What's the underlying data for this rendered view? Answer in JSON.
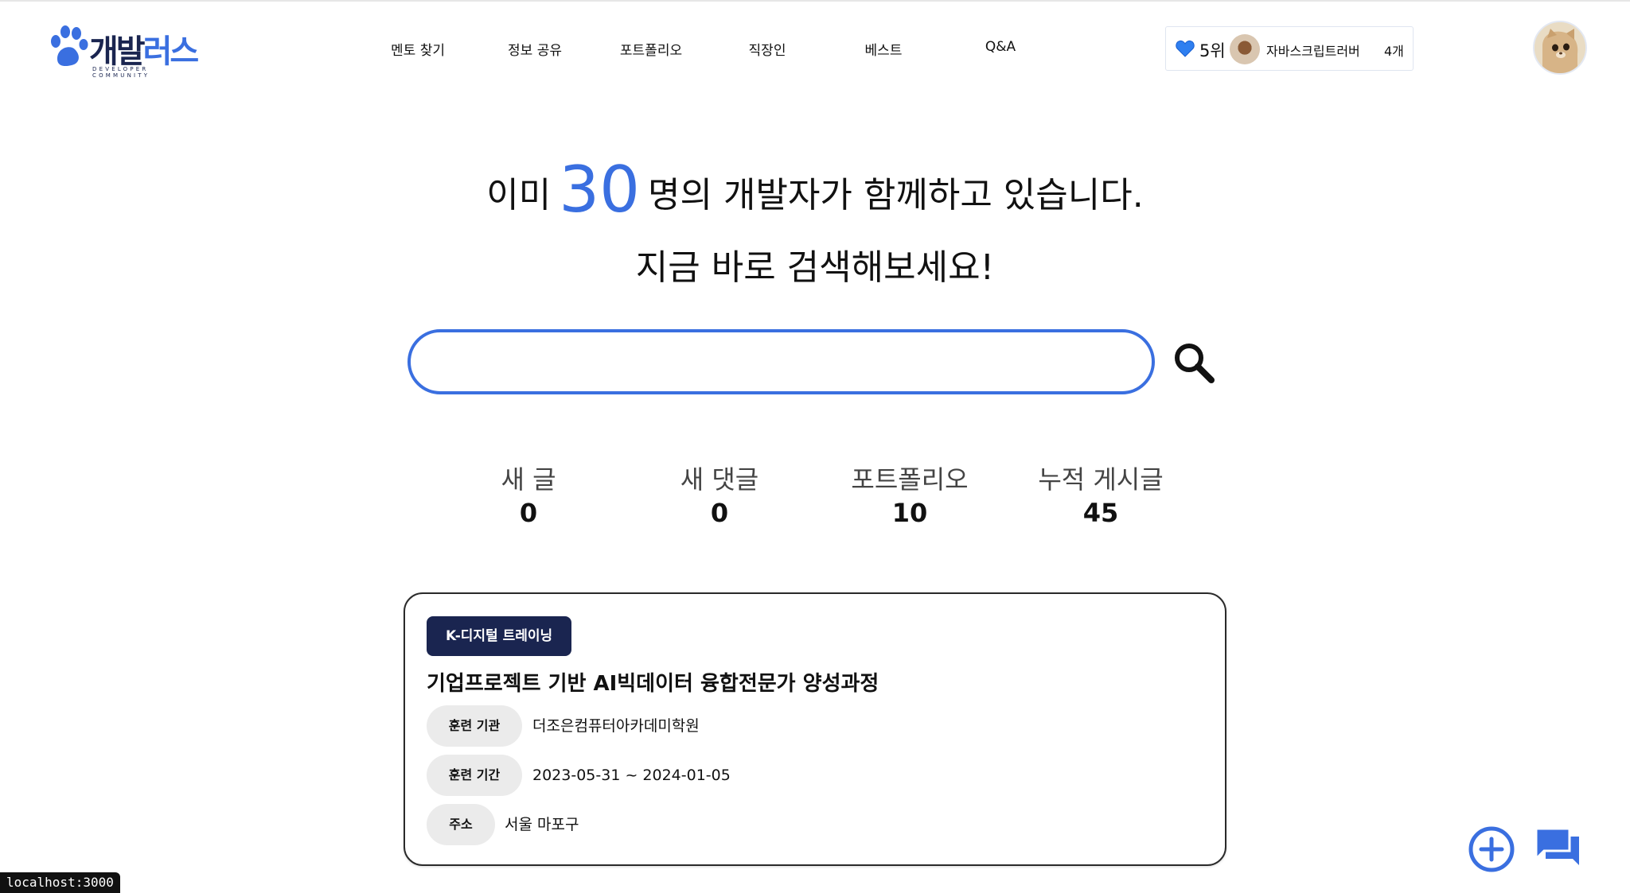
{
  "header": {
    "logo": {
      "text_main": "개발",
      "text_accent": "러스",
      "subtitle": "DEVELOPER COMMUNITY"
    },
    "nav": [
      {
        "label": "멘토 찾기",
        "name": "nav-mentor"
      },
      {
        "label": "정보 공유",
        "name": "nav-info-share"
      },
      {
        "label": "포트폴리오",
        "name": "nav-portfolio"
      },
      {
        "label": "직장인",
        "name": "nav-workers"
      },
      {
        "label": "베스트",
        "name": "nav-best"
      },
      {
        "label": "Q&A",
        "name": "nav-qna"
      }
    ],
    "rank": {
      "heart_icon": "blue-heart-icon",
      "label": "5위",
      "user": "자바스크립트러버",
      "count": "4개"
    }
  },
  "hero": {
    "prefix": "이미",
    "count": "30",
    "suffix": "명의 개발자가 함께하고 있습니다.",
    "line2": "지금 바로 검색해보세요!"
  },
  "search": {
    "value": "",
    "placeholder": ""
  },
  "stats": [
    {
      "label": "새 글",
      "value": "0"
    },
    {
      "label": "새 댓글",
      "value": "0"
    },
    {
      "label": "포트폴리오",
      "value": "10"
    },
    {
      "label": "누적 게시글",
      "value": "45"
    }
  ],
  "card": {
    "badge": "K-디지털 트레이닝",
    "title": "기업프로젝트 기반 AI빅데이터 융합전문가 양성과정",
    "rows": [
      {
        "tag": "훈련 기관",
        "value": "더조은컴퓨터아카데미학원"
      },
      {
        "tag": "훈련 기간",
        "value": "2023-05-31 ~ 2024-01-05"
      },
      {
        "tag": "주소",
        "value": "서울 마포구"
      }
    ]
  },
  "status_bar": {
    "url": "localhost:3000"
  },
  "colors": {
    "accent": "#3a6fe0",
    "navy": "#1a2550",
    "tag_bg": "#ebebeb"
  }
}
